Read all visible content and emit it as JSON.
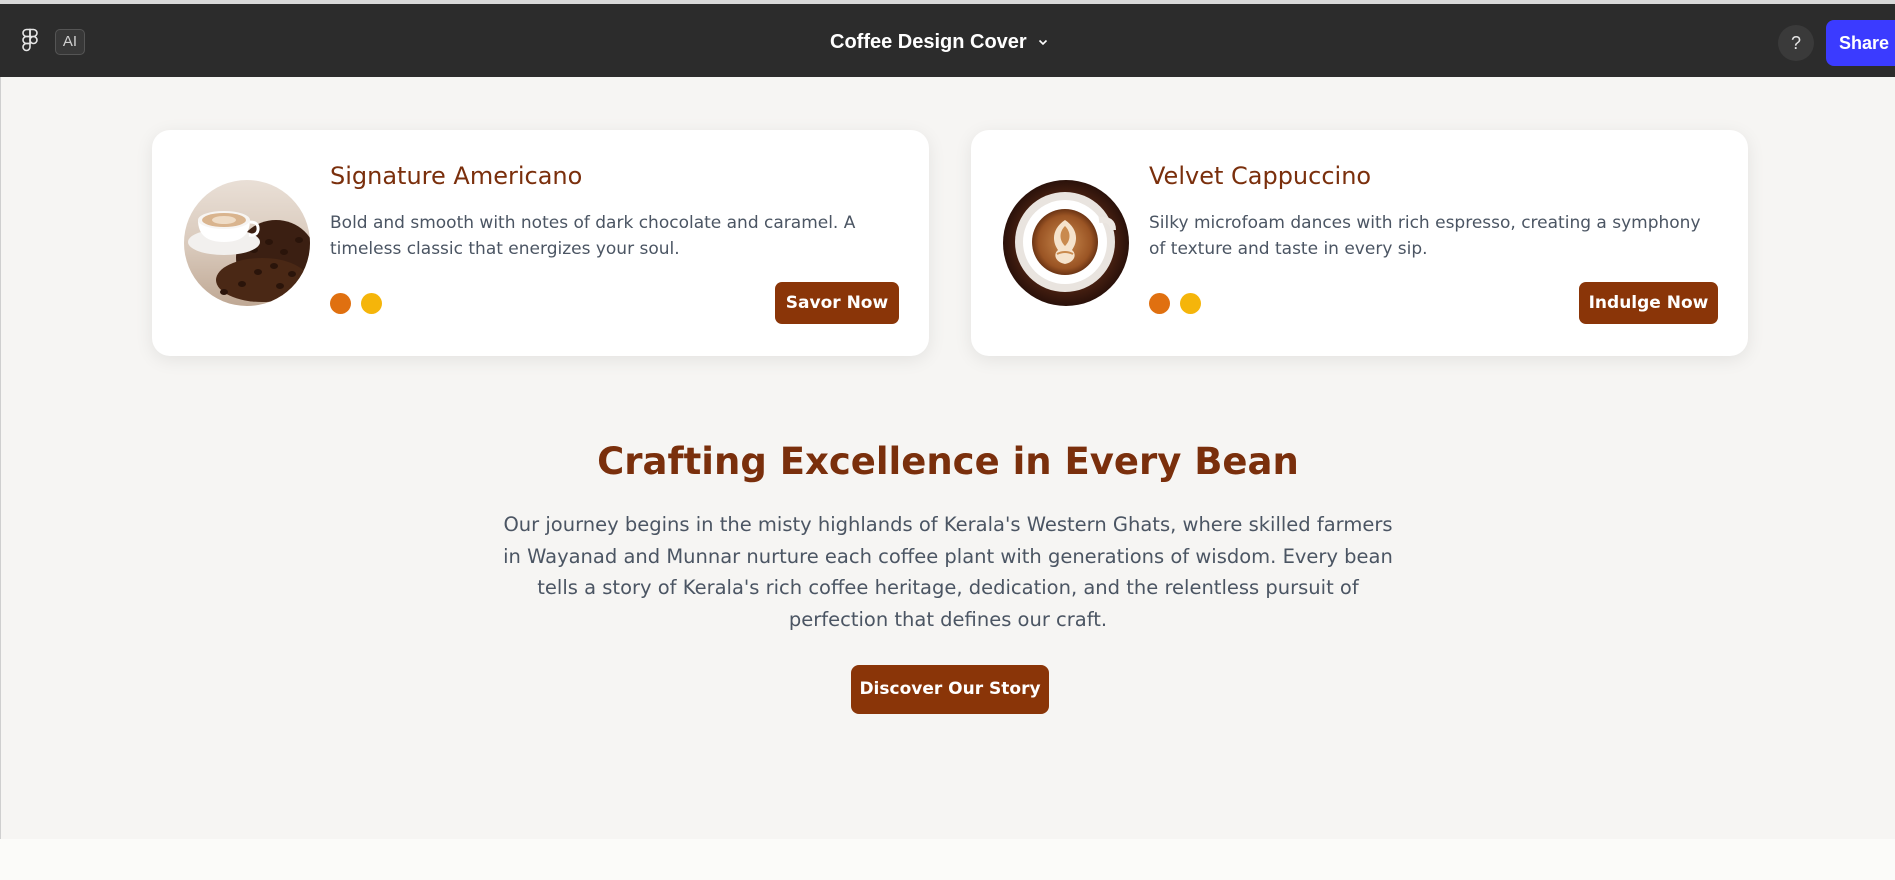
{
  "toolbar": {
    "ai_label": "AI",
    "doc_title": "Coffee Design Cover",
    "help_label": "?",
    "share_label": "Share"
  },
  "cards": [
    {
      "title": "Signature Americano",
      "description": "Bold and smooth with notes of dark chocolate and caramel. A timeless classic that energizes your soul.",
      "button": "Savor Now",
      "dot_colors": [
        "#e07010",
        "#f5b50a"
      ],
      "image": "coffee-cup-with-beans"
    },
    {
      "title": "Velvet Cappuccino",
      "description": "Silky microfoam dances with rich espresso, creating a symphony of texture and taste in every sip.",
      "button": "Indulge Now",
      "dot_colors": [
        "#e07010",
        "#f5b50a"
      ],
      "image": "latte-art-cup"
    }
  ],
  "story": {
    "heading": "Crafting Excellence in Every Bean",
    "paragraph": "Our journey begins in the misty highlands of Kerala's Western Ghats, where skilled farmers in Wayanad and Munnar nurture each coffee plant with generations of wisdom. Every bean tells a story of Kerala's rich coffee heritage, dedication, and the relentless pursuit of perfection that defines our craft.",
    "button": "Discover Our Story"
  },
  "colors": {
    "toolbar_bg": "#2c2c2c",
    "share_blue": "#3b3bff",
    "brand_brown": "#7a2f0c",
    "button_brown": "#8a3508",
    "canvas_bg": "#f6f5f3"
  }
}
